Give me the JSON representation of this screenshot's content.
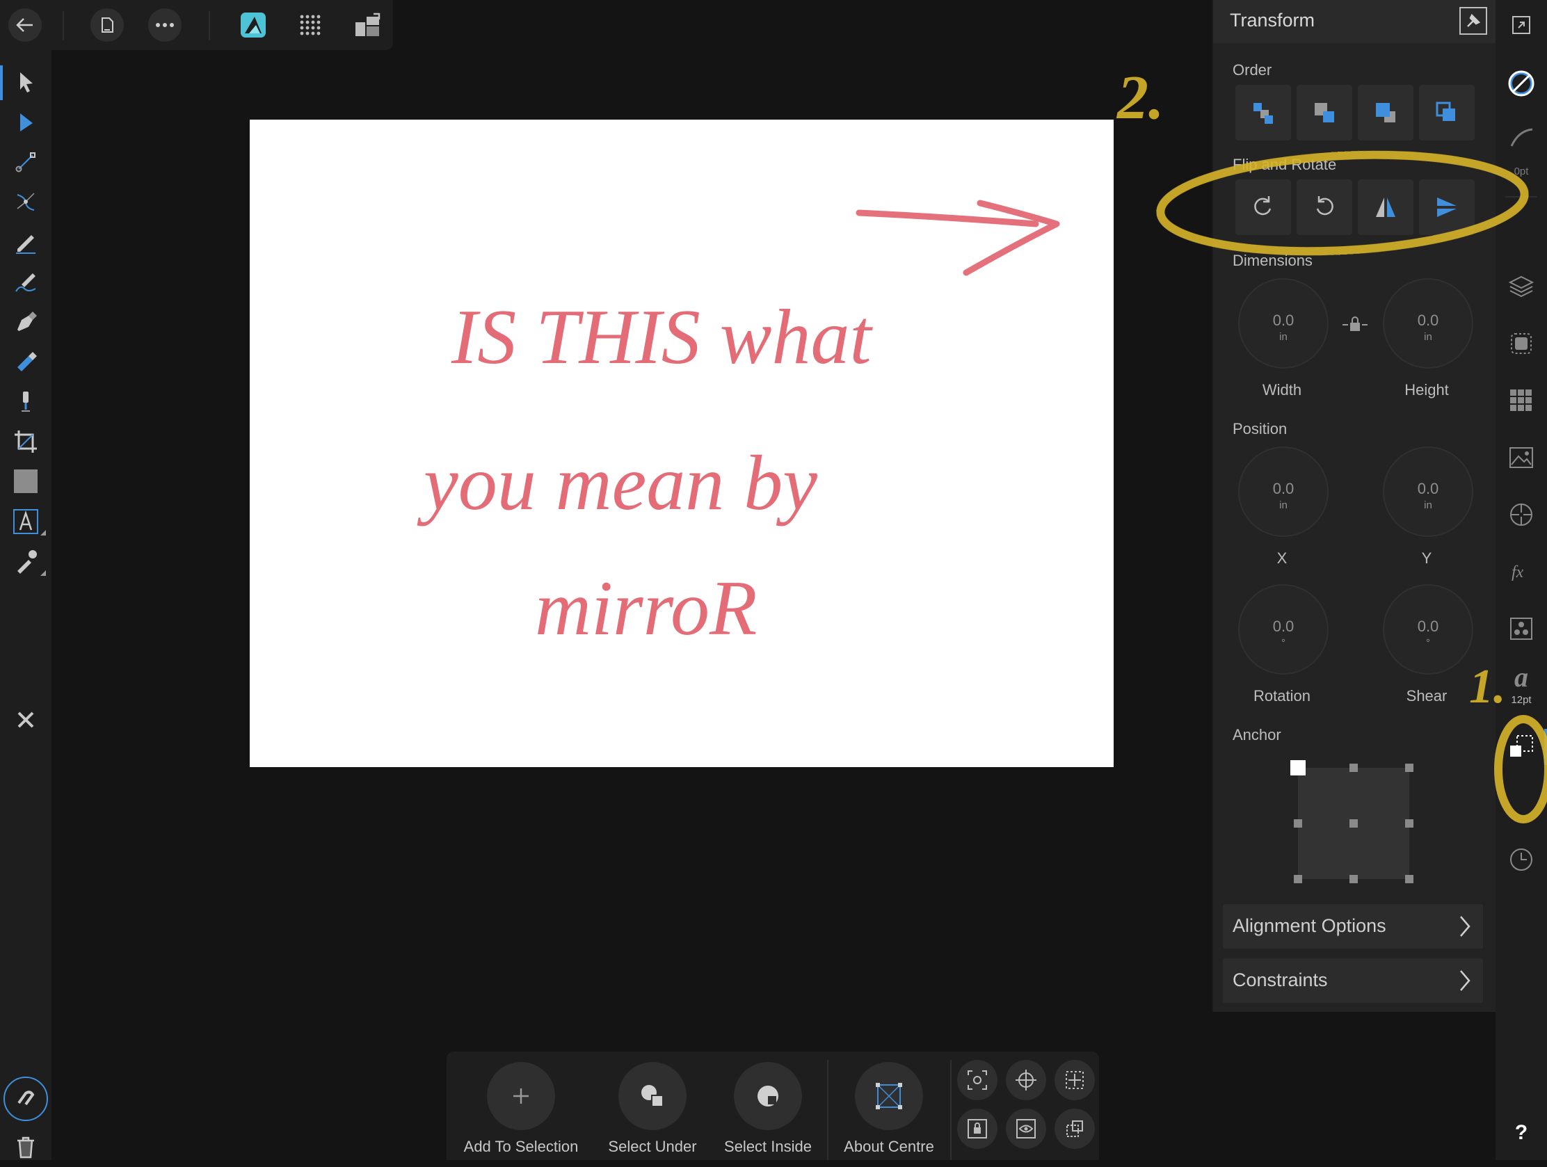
{
  "panel": {
    "title": "Transform",
    "order_label": "Order",
    "flip_rotate_label": "Flip and Rotate",
    "dimensions_label": "Dimensions",
    "position_label": "Position",
    "anchor_label": "Anchor",
    "width": {
      "value": "0.0",
      "unit": "in",
      "label": "Width"
    },
    "height": {
      "value": "0.0",
      "unit": "in",
      "label": "Height"
    },
    "x": {
      "value": "0.0",
      "unit": "in",
      "label": "X"
    },
    "y": {
      "value": "0.0",
      "unit": "in",
      "label": "Y"
    },
    "rotation": {
      "value": "0.0",
      "unit": "°",
      "label": "Rotation"
    },
    "shear": {
      "value": "0.0",
      "unit": "°",
      "label": "Shear"
    },
    "alignment_options": "Alignment Options",
    "constraints": "Constraints"
  },
  "right_column": {
    "stroke_width": "0pt",
    "font_size": "12pt",
    "text_style_glyph": "a",
    "help": "?"
  },
  "canvas": {
    "handwritten_lines": [
      "IS THIS what",
      "you mean by",
      "mirroR"
    ],
    "annotations": [
      "2.",
      "1."
    ]
  },
  "context_bar": {
    "add_to_selection": "Add To Selection",
    "select_under": "Select Under",
    "select_inside": "Select Inside",
    "about_centre": "About Centre"
  },
  "colors": {
    "accent": "#3f8fdc",
    "ink": "#e0505c",
    "highlighter": "#d8b52a",
    "app_icon": "#4fc3d6"
  },
  "icons": {
    "top": [
      "back-arrow-icon",
      "document-icon",
      "more-icon",
      "affinity-app-icon",
      "pixel-grid-icon",
      "export-persona-icon"
    ],
    "tools": [
      "move-tool-icon",
      "node-tool-icon",
      "point-transform-icon",
      "corner-tool-icon",
      "pencil-tool-icon",
      "vector-brush-icon",
      "pen-tool-icon",
      "fill-tool-icon",
      "transparency-tool-icon",
      "crop-tool-icon",
      "rectangle-tool-icon",
      "text-tool-icon",
      "color-picker-icon"
    ]
  }
}
